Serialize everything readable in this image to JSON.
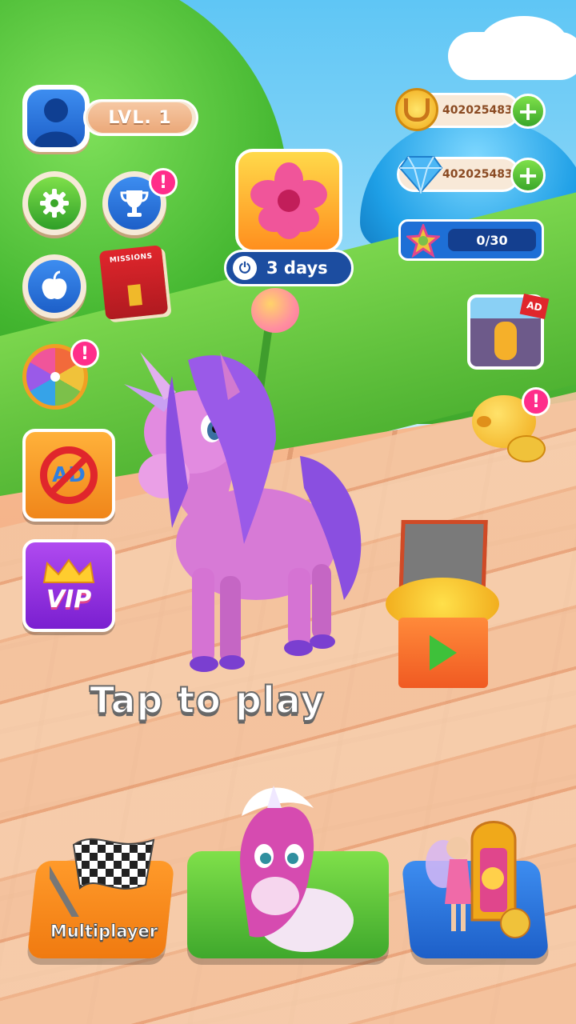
{
  "hud": {
    "level": "LVL. 1",
    "coins": "402025483",
    "gems": "402025483",
    "plus_label": "+",
    "badge_text": "!"
  },
  "event": {
    "timer": "3 days"
  },
  "progress": {
    "text": "0/30",
    "fraction": 0
  },
  "left_menu": {
    "missions_label": "MISSIONS",
    "no_ads_label": "AD",
    "vip_label": "VIP"
  },
  "right_menu": {
    "ad_label": "AD"
  },
  "main": {
    "tap_to_play": "Tap to play"
  },
  "bottom": {
    "multiplayer_label": "Multiplayer"
  },
  "colors": {
    "accent_pink": "#ff2d8a",
    "plus_green": "#3aa72a",
    "level_blue": "#1d5fc8"
  }
}
